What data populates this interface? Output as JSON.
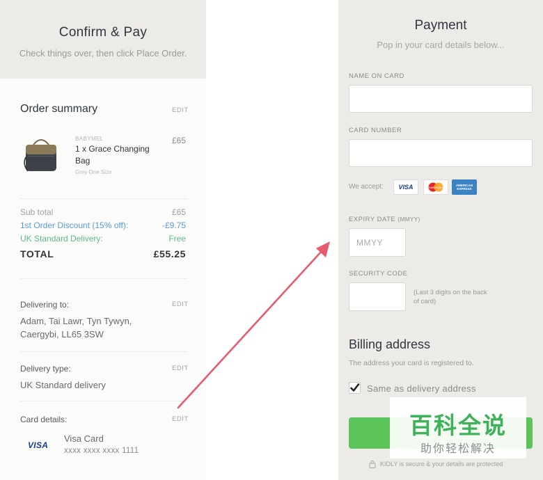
{
  "left": {
    "title": "Confirm & Pay",
    "subtitle": "Check things over, then click Place Order.",
    "order_summary": {
      "heading": "Order summary",
      "edit": "EDIT",
      "product": {
        "brand": "BABYMEL",
        "name": "1 x Grace Changing Bag",
        "variant": "Grey One Size",
        "price": "£65"
      }
    },
    "totals": {
      "subtotal_label": "Sub total",
      "subtotal_value": "£65",
      "discount_label": "1st Order Discount (15% off):",
      "discount_value": "-£9.75",
      "delivery_label": "UK Standard Delivery:",
      "delivery_value": "Free",
      "total_label": "TOTAL",
      "total_value": "£55.25"
    },
    "delivering": {
      "label": "Delivering to:",
      "edit": "EDIT",
      "line1": "Adam, Tai Lawr, Tyn Tywyn,",
      "line2": "Caergybi, LL65 3SW"
    },
    "delivery_type": {
      "label": "Delivery type:",
      "edit": "EDIT",
      "value": "UK Standard delivery"
    },
    "card_details": {
      "label": "Card details:",
      "edit": "EDIT",
      "logo": "VISA",
      "card_name": "Visa Card",
      "card_number": "xxxx xxxx xxxx 1111"
    }
  },
  "right": {
    "title": "Payment",
    "subtitle": "Pop in your card details below...",
    "name_label": "NAME ON CARD",
    "name_value": "",
    "number_label": "CARD NUMBER",
    "number_value": "",
    "we_accept": "We accept:",
    "cards": [
      "VISA",
      "mastercard",
      "AMERICAN EXPRESS"
    ],
    "expiry_label": "EXPIRY DATE",
    "expiry_format": "(MMYY)",
    "expiry_placeholder": "MMYY",
    "security_label": "SECURITY CODE",
    "security_hint": "(Last 3 digits on the back of card)",
    "billing_title": "Billing address",
    "billing_sub": "The address your card is registered to.",
    "same_as_delivery": "Same as delivery address",
    "same_checked": true,
    "secure_note": "KIDLY is secure & your details are protected"
  },
  "watermark": {
    "big": "百科全说",
    "small": "助你轻松解决"
  },
  "colors": {
    "panel_grey": "#ecebe7",
    "accent_green": "#5cc35a",
    "discount_blue": "#5b9ad8",
    "delivery_green": "#5cb890",
    "arrow_pink": "#e85a6e"
  }
}
